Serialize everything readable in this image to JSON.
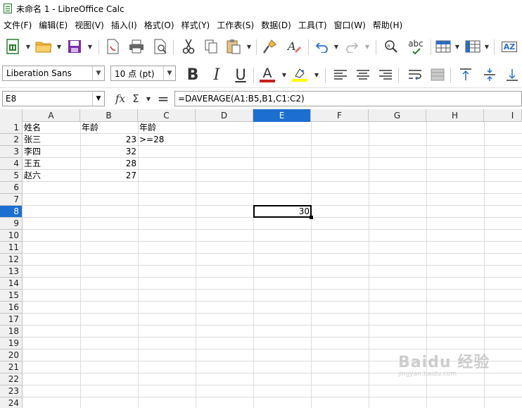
{
  "window": {
    "title": "未命名 1 - LibreOffice Calc"
  },
  "menu": [
    "文件(F)",
    "编辑(E)",
    "视图(V)",
    "插入(I)",
    "格式(O)",
    "样式(Y)",
    "工作表(S)",
    "数据(D)",
    "工具(T)",
    "窗口(W)",
    "帮助(H)"
  ],
  "toolbar": {
    "icons": [
      "new-spreadsheet-icon",
      "open-folder-icon",
      "save-icon",
      "export-pdf-icon",
      "print-icon",
      "print-preview-icon",
      "cut-icon",
      "copy-icon",
      "paste-icon",
      "clone-formatting-icon",
      "clear-formatting-icon",
      "undo-icon",
      "redo-icon",
      "find-replace-icon",
      "spelling-icon",
      "row-icon",
      "column-icon",
      "sort-icon"
    ],
    "spelling_label": "abc",
    "sort_label": "AZ"
  },
  "format_bar": {
    "font_name": "Liberation Sans",
    "font_size": "10 点 (pt)",
    "bold_label": "B",
    "italic_label": "I",
    "underline_label": "U",
    "font_color_label": "A",
    "font_color": "#c9211e",
    "highlight_color": "#ffff00"
  },
  "formula_bar": {
    "name_box": "E8",
    "fx_label": "fx",
    "sum_label": "Σ",
    "equals_label": "=",
    "formula": "=DAVERAGE(A1:B5,B1,C1:C2)"
  },
  "sheet": {
    "columns": [
      "A",
      "B",
      "C",
      "D",
      "E",
      "F",
      "G",
      "H",
      "I"
    ],
    "active_column": "E",
    "rows": [
      "1",
      "2",
      "3",
      "4",
      "5",
      "6",
      "7",
      "8",
      "9",
      "10",
      "11",
      "12",
      "13",
      "14",
      "15",
      "16",
      "17",
      "18",
      "19",
      "20",
      "21",
      "22",
      "23",
      "24"
    ],
    "active_row": "8",
    "cells": {
      "A1": "姓名",
      "B1": "年龄",
      "C1": "年龄",
      "A2": "张三",
      "B2": "23",
      "C2": ">=28",
      "A3": "李四",
      "B3": "32",
      "A4": "王五",
      "B4": "28",
      "A5": "赵六",
      "B5": "27",
      "E8": "30"
    }
  },
  "watermark": {
    "main": "Baidu 经验",
    "sub": "jingyan.baidu.com"
  }
}
